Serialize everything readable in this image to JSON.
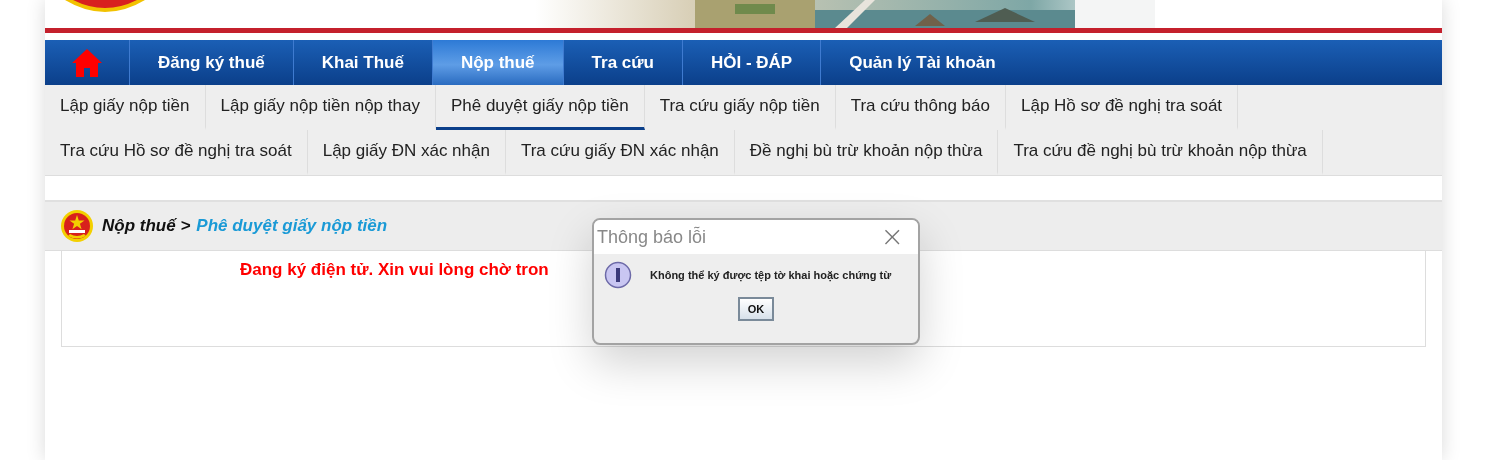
{
  "main_menu": [
    {
      "kind": "home",
      "selected": false
    },
    {
      "label": "Đăng ký thuế",
      "selected": false
    },
    {
      "label": "Khai Thuế",
      "selected": false
    },
    {
      "label": "Nộp thuế",
      "selected": true
    },
    {
      "label": "Tra cứu",
      "selected": false
    },
    {
      "label": "HỎI - ĐÁP",
      "selected": false
    },
    {
      "label": "Quản lý Tài khoản",
      "selected": false
    }
  ],
  "sub_menu": [
    {
      "label": "Lập giấy nộp tiền",
      "selected": false
    },
    {
      "label": "Lập giấy nộp tiền nộp thay",
      "selected": false
    },
    {
      "label": "Phê duyệt giấy nộp tiền",
      "selected": true
    },
    {
      "label": "Tra cứu giấy nộp tiền",
      "selected": false
    },
    {
      "label": "Tra cứu thông báo",
      "selected": false
    },
    {
      "label": "Lập Hồ sơ đề nghị tra soát",
      "selected": false
    },
    {
      "label": "Tra cứu Hồ sơ đề nghị tra soát",
      "selected": false
    },
    {
      "label": "Lập giấy ĐN xác nhận",
      "selected": false
    },
    {
      "label": "Tra cứu giấy ĐN xác nhận",
      "selected": false
    },
    {
      "label": "Đề nghị bù trừ khoản nộp thừa",
      "selected": false
    },
    {
      "label": "Tra cứu đề nghị bù trừ khoản nộp thừa",
      "selected": false
    }
  ],
  "breadcrumb": {
    "section": "Nộp thuế >",
    "current": "Phê duyệt giấy nộp tiền"
  },
  "status_message": "Đang ký điện tử. Xin vui lòng chờ tron",
  "dialog": {
    "title": "Thông báo lỗi",
    "close": "×",
    "message": "Không thể ký được tệp tờ khai hoặc chứng từ",
    "button": "OK"
  }
}
